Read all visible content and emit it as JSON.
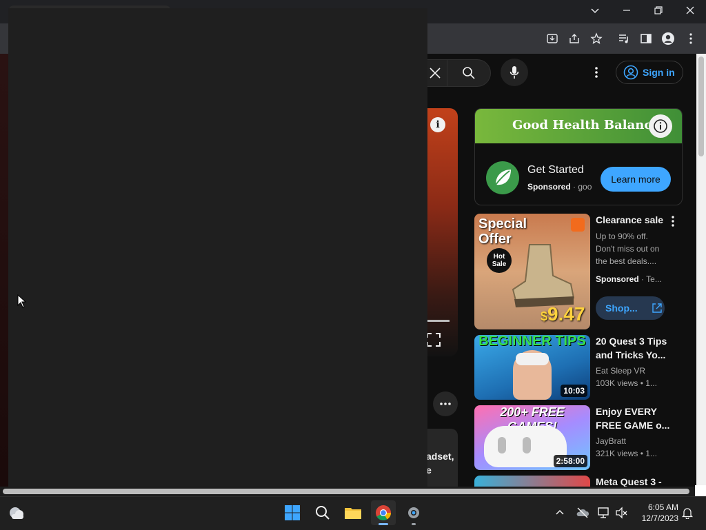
{
  "chrome": {
    "window_controls": [
      "chevron-down",
      "minimize",
      "restore",
      "close"
    ],
    "toolbar_icons": [
      "download-icon",
      "share-icon",
      "bookmark-star-icon",
      "media-control-icon",
      "side-panel-icon",
      "profile-icon",
      "more-vert-icon"
    ]
  },
  "youtube": {
    "header": {
      "sign_in_label": "Sign in"
    },
    "ad_banner": {
      "brand_title": "Good Health Balance",
      "cta_title": "Get Started",
      "sponsored_label": "Sponsored",
      "sponsored_source": "goo",
      "learn_more_label": "Learn more",
      "banner_color": "#6aa53a"
    },
    "sponsored_card": {
      "title": "Clearance sale",
      "description_line1": "Up to 90% off.",
      "description_line2": "Don't miss out on",
      "description_line3": "the best deals....",
      "sponsored_label": "Sponsored",
      "sponsored_source": "Te...",
      "shop_label": "Shop...",
      "thumb_text1": "Special",
      "thumb_text2": "Offer",
      "thumb_badge": "Hot Sale",
      "thumb_price_dollar": "$",
      "thumb_price": "9.47"
    },
    "videos": [
      {
        "title_line1": "20 Quest 3 Tips",
        "title_line2": "and Tricks Yo...",
        "channel": "Eat Sleep VR",
        "stats": "103K views",
        "age": "1...",
        "duration": "10:03",
        "thumb_text": "BEGINNER TIPS"
      },
      {
        "title_line1": "Enjoy EVERY",
        "title_line2": "FREE GAME o...",
        "channel": "JayBratt",
        "stats": "321K views",
        "age": "1...",
        "duration": "2:58:00",
        "thumb_text": "200+ FREE GAMES!"
      },
      {
        "title_line1": "Meta Quest 3 -"
      }
    ],
    "partial_text": {
      "line1": "adset,",
      "line2": "e"
    }
  },
  "taskbar": {
    "time": "6:05 AM",
    "date": "12/7/2023"
  }
}
